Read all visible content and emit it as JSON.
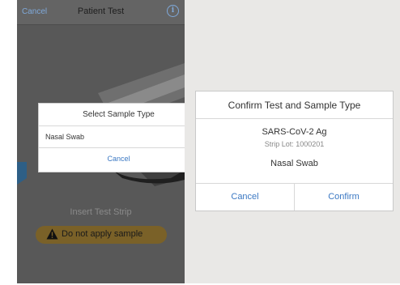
{
  "left_screen": {
    "nav": {
      "cancel_label": "Cancel",
      "title": "Patient Test",
      "info_icon": "info-icon"
    },
    "sheet": {
      "title": "Select Sample Type",
      "option": "Nasal Swab",
      "cancel_label": "Cancel"
    },
    "insert_text": "Insert Test Strip",
    "warning": {
      "icon": "warning-icon",
      "text": "Do not apply sample",
      "color": "#7a6128"
    }
  },
  "dialog": {
    "title": "Confirm Test and Sample Type",
    "test_name": "SARS-CoV-2 Ag",
    "strip_lot": "Strip Lot: 1000201",
    "sample_type": "Nasal Swab",
    "cancel_label": "Cancel",
    "confirm_label": "Confirm"
  },
  "colors": {
    "accent": "#3b78c3",
    "nav_link": "#7fa9da",
    "panel_bg": "#e9e8e6"
  }
}
